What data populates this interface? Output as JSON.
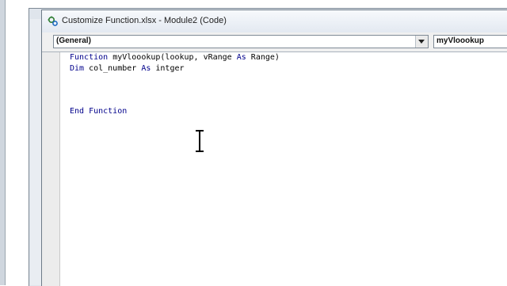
{
  "window": {
    "title": "Customize Function.xlsx - Module2 (Code)"
  },
  "toolbar": {
    "object_combo": "(General)",
    "procedure_combo": "myVloookup"
  },
  "code": {
    "line1": {
      "kw1": "Function",
      "t1": " myVloookup(lookup, vRange ",
      "kw2": "As",
      "t2": " Range)"
    },
    "line2": {
      "kw1": "Dim",
      "t1": " col_number ",
      "kw2": "As",
      "t2": " intger"
    },
    "line3": {
      "kw1": "End Function"
    }
  },
  "colors": {
    "keyword": "#00008b",
    "text": "#000000"
  },
  "icons": {
    "title_icon": "vba-module-icon",
    "dropdown": "chevron-down-icon",
    "cursor": "text-ibeam-cursor-icon"
  }
}
